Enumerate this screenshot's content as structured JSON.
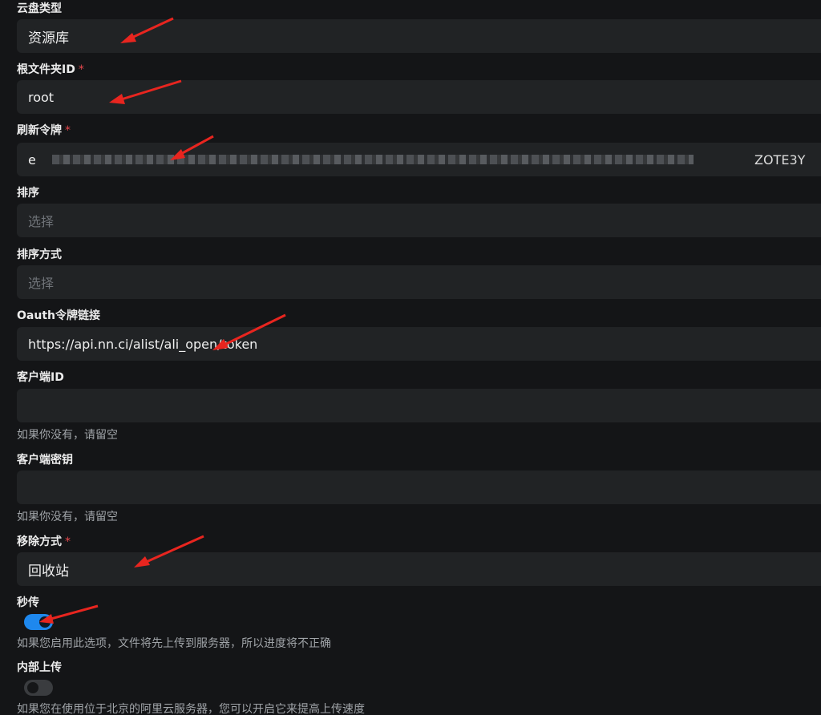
{
  "form": {
    "cloud_type": {
      "label": "云盘类型",
      "value": "资源库"
    },
    "root_folder": {
      "label": "根文件夹ID",
      "required_mark": "*",
      "value": "root"
    },
    "refresh_token": {
      "label": "刷新令牌",
      "required_mark": "*",
      "value_prefix": "e",
      "value_suffix": "ZOTE3Y"
    },
    "sort": {
      "label": "排序",
      "placeholder": "选择"
    },
    "sort_order": {
      "label": "排序方式",
      "placeholder": "选择"
    },
    "oauth_url": {
      "label": "Oauth令牌链接",
      "value": "https://api.nn.ci/alist/ali_open/token"
    },
    "client_id": {
      "label": "客户端ID",
      "value": "",
      "help": "如果你没有，请留空"
    },
    "client_secret": {
      "label": "客户端密钥",
      "value": "",
      "help": "如果你没有，请留空"
    },
    "remove_way": {
      "label": "移除方式",
      "required_mark": "*",
      "value": "回收站"
    },
    "rapid_upload": {
      "label": "秒传",
      "enabled": true,
      "help": "如果您启用此选项，文件将先上传到服务器，所以进度将不正确"
    },
    "internal_upload": {
      "label": "内部上传",
      "enabled": false,
      "help": "如果您在使用位于北京的阿里云服务器，您可以开启它来提高上传速度"
    }
  },
  "colors": {
    "background": "#141517",
    "input_bg": "#212325",
    "required": "#e5484d",
    "toggle_on": "#1e88ee",
    "annotation_arrow": "#e8251f"
  }
}
